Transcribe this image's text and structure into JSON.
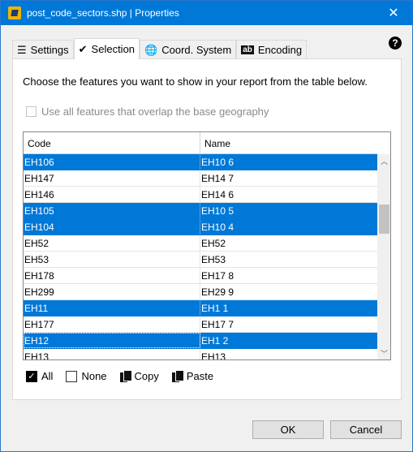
{
  "window": {
    "title": "post_code_sectors.shp | Properties",
    "close_glyph": "✕",
    "help_glyph": "?"
  },
  "tabs": [
    {
      "label": "Settings",
      "icon": "list-check-icon",
      "glyph": "☰"
    },
    {
      "label": "Selection",
      "icon": "checkmark-icon",
      "glyph": "✔",
      "active": true
    },
    {
      "label": "Coord. System",
      "icon": "globe-icon",
      "glyph": "🌐"
    },
    {
      "label": "Encoding",
      "icon": "encoding-icon",
      "glyph": "ab"
    }
  ],
  "selection": {
    "instruction": "Choose the features you want to show in your report from the table below.",
    "overlap_label": "Use all features that overlap the base geography",
    "columns": [
      "Code",
      "Name"
    ],
    "rows": [
      {
        "code": "EH106",
        "name": "EH10 6",
        "selected": true
      },
      {
        "code": "EH147",
        "name": "EH14 7",
        "selected": false
      },
      {
        "code": "EH146",
        "name": "EH14 6",
        "selected": false
      },
      {
        "code": "EH105",
        "name": "EH10 5",
        "selected": true
      },
      {
        "code": "EH104",
        "name": "EH10 4",
        "selected": true
      },
      {
        "code": "EH52",
        "name": "EH52",
        "selected": false
      },
      {
        "code": "EH53",
        "name": "EH53",
        "selected": false
      },
      {
        "code": "EH178",
        "name": "EH17 8",
        "selected": false
      },
      {
        "code": "EH299",
        "name": "EH29 9",
        "selected": false
      },
      {
        "code": "EH11",
        "name": "EH1 1",
        "selected": true
      },
      {
        "code": "EH177",
        "name": "EH17 7",
        "selected": false
      },
      {
        "code": "EH12",
        "name": "EH1 2",
        "selected": true,
        "focused": true
      },
      {
        "code": "EH13",
        "name": "EH13",
        "selected": false
      }
    ],
    "actions": {
      "all_label": "All",
      "none_label": "None",
      "copy_label": "Copy",
      "paste_label": "Paste"
    }
  },
  "footer": {
    "ok_label": "OK",
    "cancel_label": "Cancel"
  },
  "colors": {
    "titlebar": "#0078d7",
    "selection": "#0078d7"
  }
}
